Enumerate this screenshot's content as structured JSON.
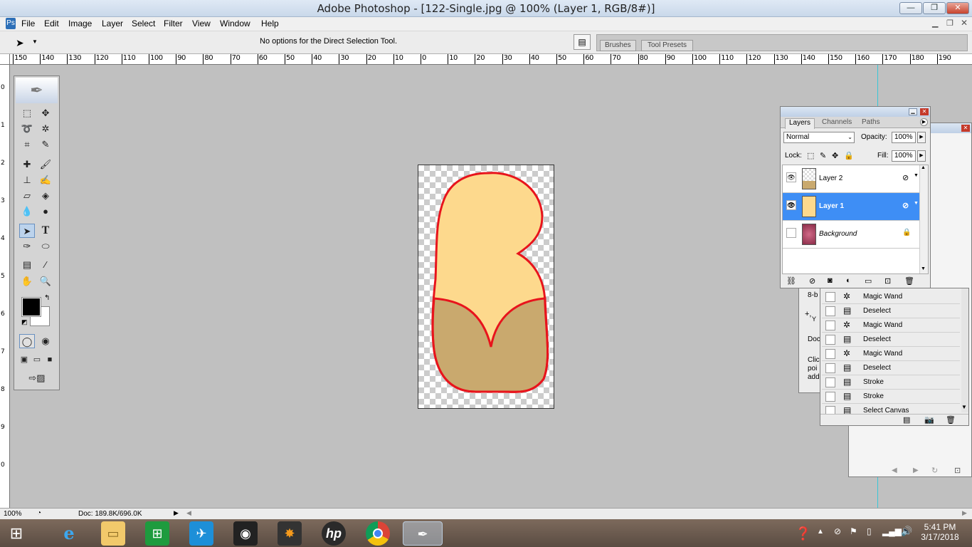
{
  "window": {
    "title": "Adobe Photoshop - [122-Single.jpg @ 100% (Layer 1, RGB/8#)]"
  },
  "menu": [
    "File",
    "Edit",
    "Image",
    "Layer",
    "Select",
    "Filter",
    "View",
    "Window",
    "Help"
  ],
  "options": {
    "message": "No options for the Direct Selection Tool.",
    "tab_brushes": "Brushes",
    "tab_tool_presets": "Tool Presets"
  },
  "ruler": {
    "top": [
      "150",
      "140",
      "130",
      "120",
      "110",
      "100",
      "90",
      "80",
      "70",
      "60",
      "50",
      "40",
      "30",
      "20",
      "10",
      "0",
      "10",
      "20",
      "30",
      "40",
      "50",
      "60",
      "70",
      "80",
      "90",
      "100",
      "110",
      "120",
      "130",
      "140",
      "150",
      "160",
      "170",
      "180",
      "190"
    ],
    "left": [
      "0",
      "1",
      "2",
      "3",
      "4",
      "5",
      "6",
      "7",
      "8",
      "9",
      "0"
    ]
  },
  "layers_panel": {
    "tabs": [
      "Layers",
      "Channels",
      "Paths"
    ],
    "blend_mode": "Normal",
    "opacity_label": "Opacity:",
    "opacity": "100%",
    "lock_label": "Lock:",
    "fill_label": "Fill:",
    "fill": "100%",
    "layers": [
      {
        "name": "Layer 2",
        "visible": true,
        "selected": false
      },
      {
        "name": "Layer 1",
        "visible": true,
        "selected": true
      },
      {
        "name": "Background",
        "visible": false,
        "selected": false,
        "locked": true
      }
    ]
  },
  "info_panel_fragments": {
    "bits": "8-b",
    "plus": "+,",
    "plus_y": "Y",
    "doc": "Doc",
    "hint1": "Clic",
    "hint2": "poi",
    "hint3": "add"
  },
  "history": [
    {
      "label": "Magic Wand",
      "icon": "magic-wand-icon"
    },
    {
      "label": "Deselect",
      "icon": "document-icon"
    },
    {
      "label": "Magic Wand",
      "icon": "magic-wand-icon"
    },
    {
      "label": "Deselect",
      "icon": "document-icon"
    },
    {
      "label": "Magic Wand",
      "icon": "magic-wand-icon"
    },
    {
      "label": "Deselect",
      "icon": "document-icon"
    },
    {
      "label": "Stroke",
      "icon": "document-icon"
    },
    {
      "label": "Stroke",
      "icon": "document-icon"
    },
    {
      "label": "Select Canvas",
      "icon": "document-icon"
    }
  ],
  "status": {
    "zoom": "100%",
    "doc": "Doc: 189.8K/696.0K"
  },
  "taskbar": {
    "time": "5:41 PM",
    "date": "3/17/2018"
  },
  "colors": {
    "shape_top": "#fdd98d",
    "shape_bottom": "#c9a96e",
    "outline": "#e8141c",
    "selection": "#3e8ef5"
  }
}
